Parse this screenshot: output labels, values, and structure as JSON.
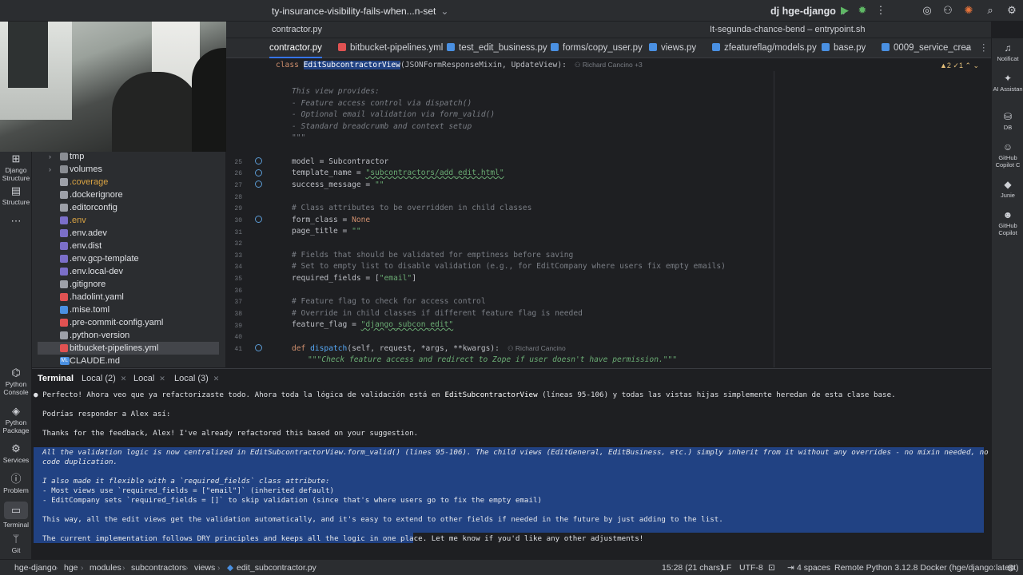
{
  "window": {
    "branch": "ty-insurance-visibility-fails-when...n-set",
    "project": "hge-django",
    "project_muted": "",
    "run_config": "It-segunda-chance-bend – entrypoint.sh"
  },
  "strip2": {
    "left_file": "contractor.py"
  },
  "tabs": [
    {
      "label": "contractor.py",
      "color": "#4a90e2",
      "active": true
    },
    {
      "label": "bitbucket-pipelines.yml",
      "color": "#e05252",
      "active": false
    },
    {
      "label": "test_edit_business.py",
      "color": "#4a90e2",
      "active": false
    },
    {
      "label": "forms/copy_user.py",
      "color": "#4a90e2",
      "active": false
    },
    {
      "label": "views.py",
      "color": "#4a90e2",
      "active": false
    },
    {
      "label": "zfeatureflag/models.py",
      "color": "#4a90e2",
      "active": false
    },
    {
      "label": "base.py",
      "color": "#4a90e2",
      "active": false
    },
    {
      "label": "0009_service_crea",
      "color": "#4a90e2",
      "active": false
    }
  ],
  "editor": {
    "sticky_prefix": "class ",
    "sticky_class": "EditSubcontractorView",
    "sticky_rest": "(JSONFormResponseMixin, UpdateView):",
    "sticky_blame": "Richard Cancino +3",
    "warnings": "▲2  ✓1  ⌃  ⌄",
    "docstring": [
      "This view provides:",
      "- Feature access control via dispatch()",
      "- Optional email validation via form_valid()",
      "- Standard breadcrumb and context setup",
      "\"\"\""
    ],
    "line_numbers": [
      "25",
      "26",
      "27",
      "28",
      "29",
      "30",
      "31",
      "32",
      "33",
      "34",
      "35",
      "36",
      "37",
      "38",
      "39",
      "40",
      "41"
    ],
    "lines": {
      "l25": "model = Subcontractor",
      "l26_a": "template_name = ",
      "l26_b": "\"subcontractors/add_edit.html\"",
      "l27_a": "success_message = ",
      "l27_b": "\"\"",
      "l29": "# Class attributes to be overridden in child classes",
      "l30_a": "form_class = ",
      "l30_b": "None",
      "l31_a": "page_title = ",
      "l31_b": "\"\"",
      "l33": "# Fields that should be validated for emptiness before saving",
      "l34": "# Set to empty list to disable validation (e.g., for EditCompany where users fix empty emails)",
      "l35_a": "required_fields = [",
      "l35_b": "\"email\"",
      "l35_c": "]",
      "l37": "# Feature flag to check for access control",
      "l38": "# Override in child classes if different feature flag is needed",
      "l39_a": "feature_flag = ",
      "l39_b": "\"django_subcon_edit\"",
      "l41_a": "def ",
      "l41_b": "dispatch",
      "l41_c": "(self, request, *args, **kwargs):",
      "l41_blame": "Richard Cancino",
      "l42": "\"\"\"Check feature access and redirect to Zope if user doesn't have permission.\"\"\""
    }
  },
  "tree": [
    {
      "name": "tmp",
      "type": "folder",
      "color": "#8a8d93"
    },
    {
      "name": "volumes",
      "type": "folder",
      "color": "#8a8d93"
    },
    {
      "name": ".coverage",
      "type": "file",
      "color": "#d9a343",
      "text_color": "#d9a343"
    },
    {
      "name": ".dockerignore",
      "type": "file",
      "color": "#9da0a8"
    },
    {
      "name": ".editorconfig",
      "type": "file",
      "color": "#9da0a8"
    },
    {
      "name": ".env",
      "type": "file",
      "color": "#7b6fc9",
      "text_color": "#d9a343"
    },
    {
      "name": ".env.adev",
      "type": "file",
      "color": "#7b6fc9"
    },
    {
      "name": ".env.dist",
      "type": "file",
      "color": "#7b6fc9"
    },
    {
      "name": ".env.gcp-template",
      "type": "file",
      "color": "#7b6fc9"
    },
    {
      "name": ".env.local-dev",
      "type": "file",
      "color": "#7b6fc9"
    },
    {
      "name": ".gitignore",
      "type": "file",
      "color": "#9da0a8"
    },
    {
      "name": ".hadolint.yaml",
      "type": "file",
      "color": "#e05252"
    },
    {
      "name": ".mise.toml",
      "type": "file",
      "color": "#4a90e2"
    },
    {
      "name": ".pre-commit-config.yaml",
      "type": "file",
      "color": "#e05252"
    },
    {
      "name": ".python-version",
      "type": "file",
      "color": "#9da0a8"
    },
    {
      "name": "bitbucket-pipelines.yml",
      "type": "file",
      "color": "#e05252",
      "selected": true
    },
    {
      "name": "CLAUDE.md",
      "type": "file",
      "color": "#4a90e2",
      "prefix": "M↓"
    }
  ],
  "leftbar": [
    {
      "label": "Django Structure",
      "icon": "django-structure-icon",
      "glyph": "⊞"
    },
    {
      "label": "Structure",
      "icon": "structure-icon",
      "glyph": "▤"
    },
    {
      "label": "",
      "icon": "more-icon",
      "glyph": "⋯"
    },
    {
      "label": "Python Console",
      "icon": "python-console-icon",
      "glyph": "⌬"
    },
    {
      "label": "Python Package",
      "icon": "python-package-icon",
      "glyph": "◈"
    },
    {
      "label": "Services",
      "icon": "services-icon",
      "glyph": "⚙"
    },
    {
      "label": "Problem",
      "icon": "problems-icon",
      "glyph": "ⓘ"
    },
    {
      "label": "Terminal",
      "icon": "terminal-icon",
      "glyph": "▭",
      "selected": true
    },
    {
      "label": "Git",
      "icon": "git-icon",
      "glyph": "ᛘ"
    }
  ],
  "rightbar": [
    {
      "label": "Notificat",
      "icon": "bell-icon",
      "glyph": "🔔"
    },
    {
      "label": "AI Assistan",
      "icon": "ai-assistant-icon",
      "glyph": "✦"
    },
    {
      "label": "DB",
      "icon": "database-icon",
      "glyph": "⛁"
    },
    {
      "label": "GitHub Copilot C",
      "icon": "copilot-chat-icon",
      "glyph": "☺"
    },
    {
      "label": "Junie",
      "icon": "junie-icon",
      "glyph": "◆"
    },
    {
      "label": "GitHub Copilot",
      "icon": "copilot-icon",
      "glyph": "☻"
    }
  ],
  "terminal": {
    "tabs": [
      "Terminal",
      "Local (2)",
      "Local",
      "Local (3)"
    ],
    "line1_a": "Perfecto! Ahora veo que ya refactorizaste todo. Ahora toda la lógica de validación está en ",
    "line1_b": "EditSubcontractorView",
    "line1_c": " (líneas 95-106) y todas las vistas hijas simplemente heredan de esta clase base.",
    "line2": "Podrías responder a Alex así:",
    "line3": "Thanks for the feedback, Alex! I've already refactored this based on your suggestion.",
    "sel1": "All the validation logic is now centralized in EditSubcontractorView.form_valid() (lines 95-106). The child views (EditGeneral, EditBusiness, etc.) simply inherit from it without any overrides - no mixin needed, no",
    "sel2": "code duplication.",
    "sel3": "I also made it flexible with a `required_fields` class attribute:",
    "sel4": "- Most views use `required_fields = [\"email\"]` (inherited default)",
    "sel5": "- EditCompany sets `required_fields = []` to skip validation (since that's where users go to fix the empty email)",
    "sel6": "This way, all the edit views get the validation automatically, and it's easy to extend to other fields if needed in the future by just adding to the list.",
    "sel7": "The current implementation follows DRY principles and keeps all the logic in one place.",
    "tail": " Let me know if you'd like any other adjustments!"
  },
  "statusbar": {
    "breadcrumb": [
      "hge-django",
      "hge",
      "modules",
      "subcontractors",
      "views",
      "edit_subcontractor.py"
    ],
    "position": "15:28 (21 chars)",
    "line_sep": "LF",
    "encoding": "UTF-8",
    "indent": "4 spaces",
    "interpreter": "Remote Python 3.12.8 Docker (hge/django:latest)"
  }
}
